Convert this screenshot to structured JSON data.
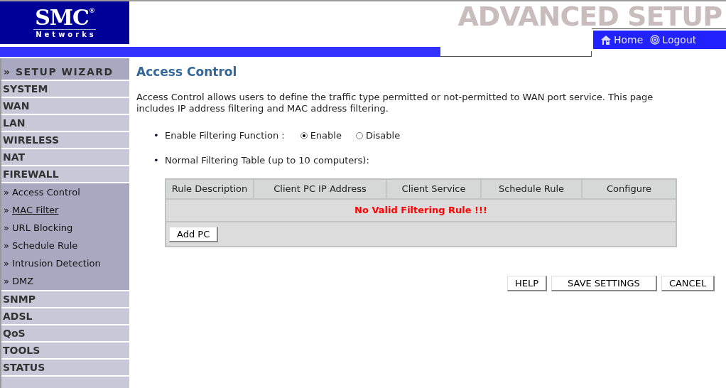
{
  "header": {
    "logo": {
      "name": "SMC",
      "mark": "®",
      "tagline": "Networks"
    },
    "banner": "ADVANCED SETUP",
    "nav": [
      {
        "kind": "home",
        "label": "Home"
      },
      {
        "kind": "logout",
        "label": "Logout"
      }
    ]
  },
  "sidebar": {
    "items": [
      {
        "kind": "wizard",
        "label": "» SETUP WIZARD"
      },
      {
        "kind": "section",
        "label": "SYSTEM"
      },
      {
        "kind": "section",
        "label": "WAN"
      },
      {
        "kind": "section",
        "label": "LAN"
      },
      {
        "kind": "section",
        "label": "WIRELESS"
      },
      {
        "kind": "section",
        "label": "NAT"
      },
      {
        "kind": "section",
        "label": "FIREWALL",
        "expanded": true,
        "children": [
          {
            "prefix": "»",
            "label": "Access Control",
            "hovered": false
          },
          {
            "prefix": "»",
            "label": "MAC Filter",
            "hovered": true
          },
          {
            "prefix": "»",
            "label": "URL Blocking",
            "hovered": false
          },
          {
            "prefix": "»",
            "label": "Schedule Rule",
            "hovered": false
          },
          {
            "prefix": "»",
            "label": "Intrusion Detection",
            "hovered": false
          },
          {
            "prefix": "»",
            "label": "DMZ",
            "hovered": false
          }
        ]
      },
      {
        "kind": "section",
        "label": "SNMP"
      },
      {
        "kind": "section",
        "label": "ADSL"
      },
      {
        "kind": "section",
        "label": "QoS"
      },
      {
        "kind": "section",
        "label": "TOOLS"
      },
      {
        "kind": "section",
        "label": "STATUS"
      }
    ]
  },
  "content": {
    "title": "Access Control",
    "description": "Access Control allows users to define the traffic type permitted or not-permitted to WAN port service. This page includes IP address filtering and MAC address filtering.",
    "filtering": {
      "marker": "•",
      "label": "Enable Filtering Function :",
      "options": [
        {
          "label": "Enable",
          "selected": true
        },
        {
          "label": "Disable",
          "selected": false
        }
      ]
    },
    "table_marker": "•",
    "table_label": "Normal Filtering Table (up to 10 computers):",
    "table": {
      "columns": [
        "Rule Description",
        "Client PC IP Address",
        "Client Service",
        "Schedule Rule",
        "Configure"
      ],
      "message": "No Valid Filtering Rule !!!",
      "add_button": "Add PC"
    },
    "buttons": [
      "HELP",
      "SAVE SETTINGS",
      "CANCEL"
    ]
  }
}
